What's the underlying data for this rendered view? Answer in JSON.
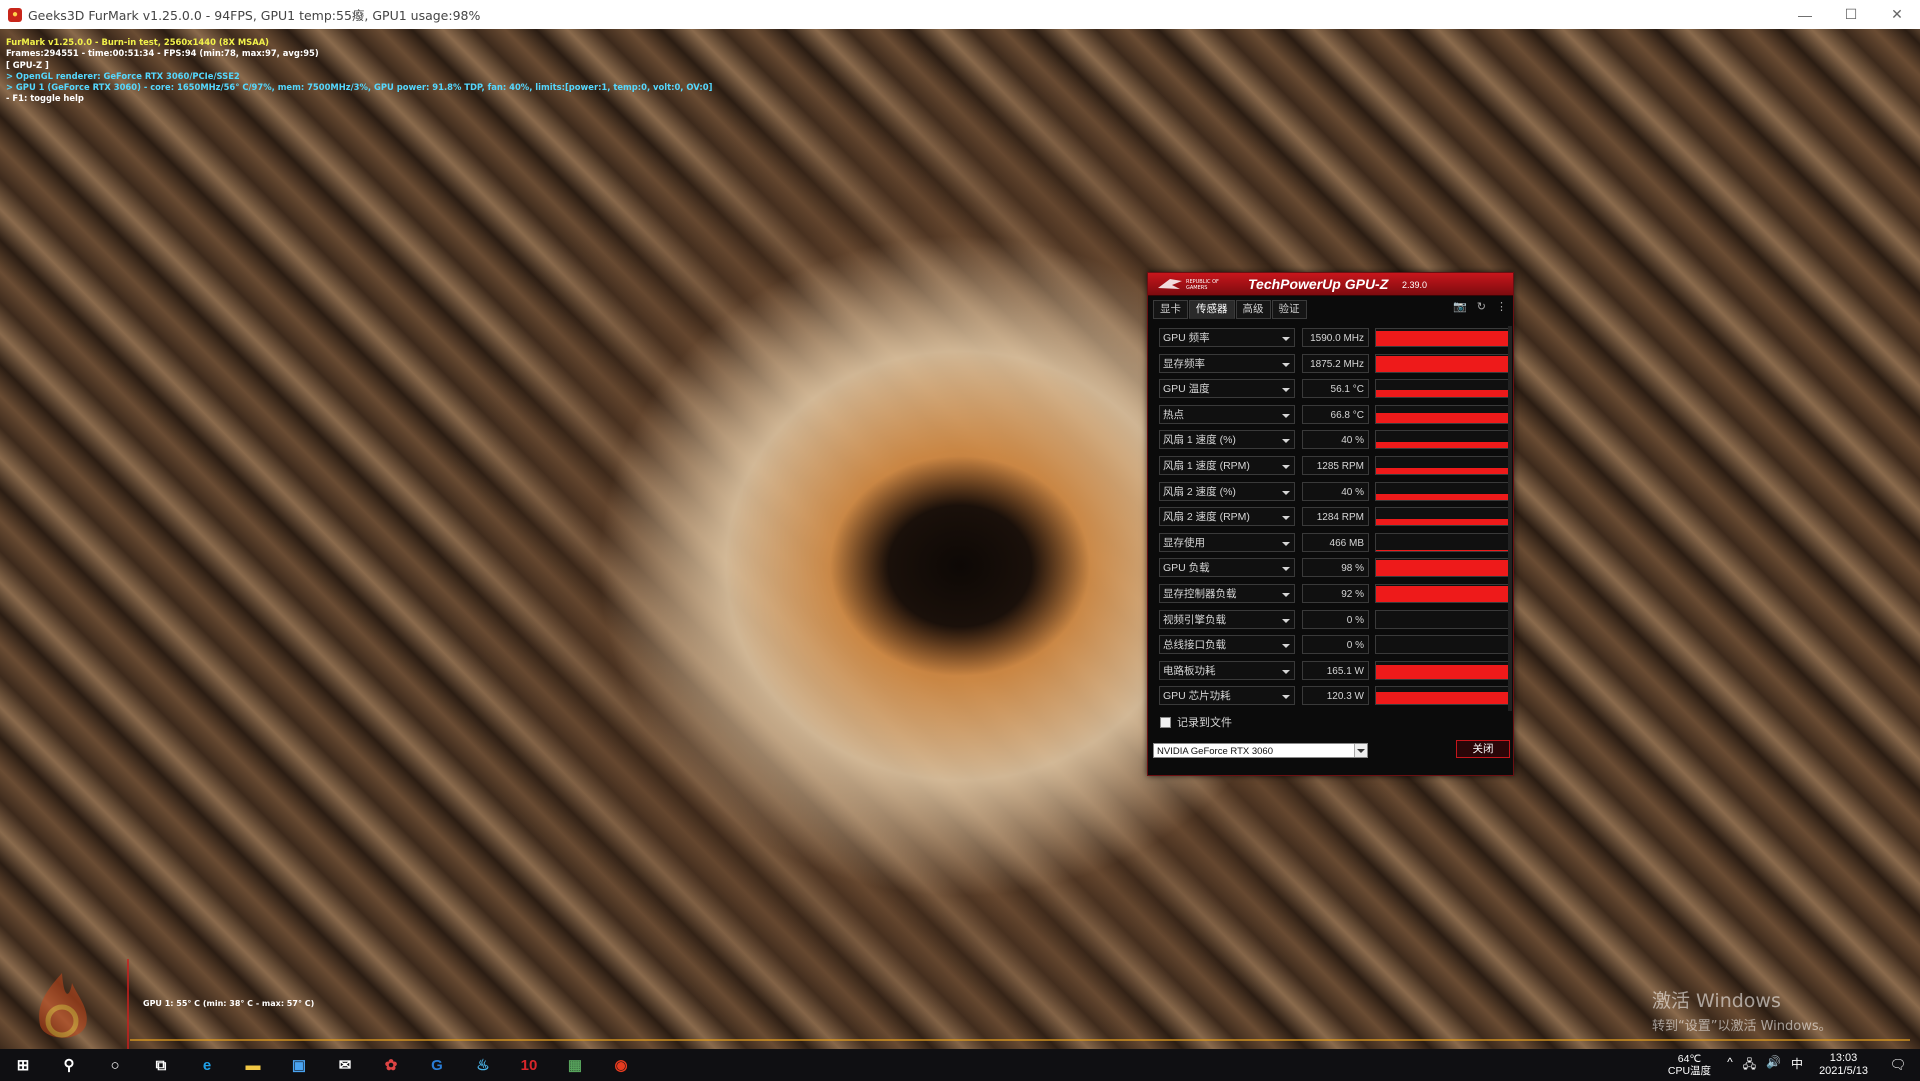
{
  "window": {
    "title": "Geeks3D FurMark v1.25.0.0 - 94FPS, GPU1 temp:55癈, GPU1 usage:98%",
    "min_glyph": "—",
    "max_glyph": "☐",
    "close_glyph": "✕"
  },
  "overlay": {
    "line1": "FurMark v1.25.0.0 - Burn-in test, 2560x1440 (8X MSAA)",
    "line2": "Frames:294551 - time:00:51:34 - FPS:94 (min:78, max:97, avg:95)",
    "line3": "[ GPU-Z ]",
    "line4": "> OpenGL renderer: GeForce RTX 3060/PCIe/SSE2",
    "line5": "> GPU 1 (GeForce RTX 3060) - core: 1650MHz/56° C/97%, mem: 7500MHz/3%, GPU power: 91.8% TDP, fan: 40%, limits:[power:1, temp:0, volt:0, OV:0]",
    "line6": "- F1: toggle help"
  },
  "temp_graph": {
    "label": "GPU 1: 55° C (min: 38° C - max: 57° C)",
    "line_color": "#e8a21e"
  },
  "watermark": {
    "line1": "激活 Windows",
    "line2": "转到“设置”以激活 Windows。"
  },
  "gpuz": {
    "title": "TechPowerUp GPU-Z",
    "version": "2.39.0",
    "tabs": [
      "显卡",
      "传感器",
      "高级",
      "验证"
    ],
    "active_tab": "传感器",
    "tools": {
      "camera": "📷",
      "refresh": "↻",
      "menu": "⋮"
    },
    "sensors": [
      {
        "name": "GPU 频率",
        "value": "1590.0 MHz",
        "level": 0.9
      },
      {
        "name": "显存频率",
        "value": "1875.2 MHz",
        "level": 0.9
      },
      {
        "name": "GPU 温度",
        "value": "56.1 °C",
        "level": 0.4
      },
      {
        "name": "热点",
        "value": "66.8 °C",
        "level": 0.55
      },
      {
        "name": "风扇 1 速度 (%)",
        "value": "40 %",
        "level": 0.35
      },
      {
        "name": "风扇 1 速度 (RPM)",
        "value": "1285 RPM",
        "level": 0.35
      },
      {
        "name": "风扇 2 速度 (%)",
        "value": "40 %",
        "level": 0.35
      },
      {
        "name": "风扇 2 速度 (RPM)",
        "value": "1284 RPM",
        "level": 0.35
      },
      {
        "name": "显存使用",
        "value": "466 MB",
        "level": 0.03
      },
      {
        "name": "GPU 负载",
        "value": "98 %",
        "level": 0.98
      },
      {
        "name": "显存控制器负载",
        "value": "92 %",
        "level": 0.92
      },
      {
        "name": "视频引擎负载",
        "value": "0 %",
        "level": 0
      },
      {
        "name": "总线接口负载",
        "value": "0 %",
        "level": 0
      },
      {
        "name": "电路板功耗",
        "value": "165.1 W",
        "level": 0.8
      },
      {
        "name": "GPU 芯片功耗",
        "value": "120.3 W",
        "level": 0.7
      }
    ],
    "log_to_file": "记录到文件",
    "gpu_select": "NVIDIA GeForce RTX 3060",
    "close_button": "关闭",
    "bar_color": "#ee1a1a"
  },
  "taskbar": {
    "apps": [
      {
        "name": "start",
        "glyph": "⊞",
        "color": "#ffffff"
      },
      {
        "name": "search",
        "glyph": "⚲",
        "color": "#ffffff"
      },
      {
        "name": "cortana",
        "glyph": "○",
        "color": "#ffffff"
      },
      {
        "name": "task-view",
        "glyph": "⧉",
        "color": "#ffffff"
      },
      {
        "name": "edge",
        "glyph": "e",
        "color": "#1fa0e8"
      },
      {
        "name": "file-explorer",
        "glyph": "▬",
        "color": "#f2c744"
      },
      {
        "name": "store",
        "glyph": "▣",
        "color": "#4aa3f0"
      },
      {
        "name": "mail",
        "glyph": "✉",
        "color": "#ffffff"
      },
      {
        "name": "app-colorful",
        "glyph": "✿",
        "color": "#d44"
      },
      {
        "name": "app-g",
        "glyph": "G",
        "color": "#2a7cd4"
      },
      {
        "name": "steam",
        "glyph": "♨",
        "color": "#4ab3e8"
      },
      {
        "name": "app-10",
        "glyph": "10",
        "color": "#d8262a"
      },
      {
        "name": "gpuz",
        "glyph": "▦",
        "color": "#57a35c"
      },
      {
        "name": "furmark",
        "glyph": "◉",
        "color": "#e63b1f"
      }
    ],
    "cpu_temp": "64℃",
    "cpu_label": "CPU温度",
    "tray": {
      "chevron": "^",
      "network": "🖧",
      "volume": "🔊",
      "ime": "中"
    },
    "time": "13:03",
    "date": "2021/5/13",
    "notification": "🗨"
  }
}
